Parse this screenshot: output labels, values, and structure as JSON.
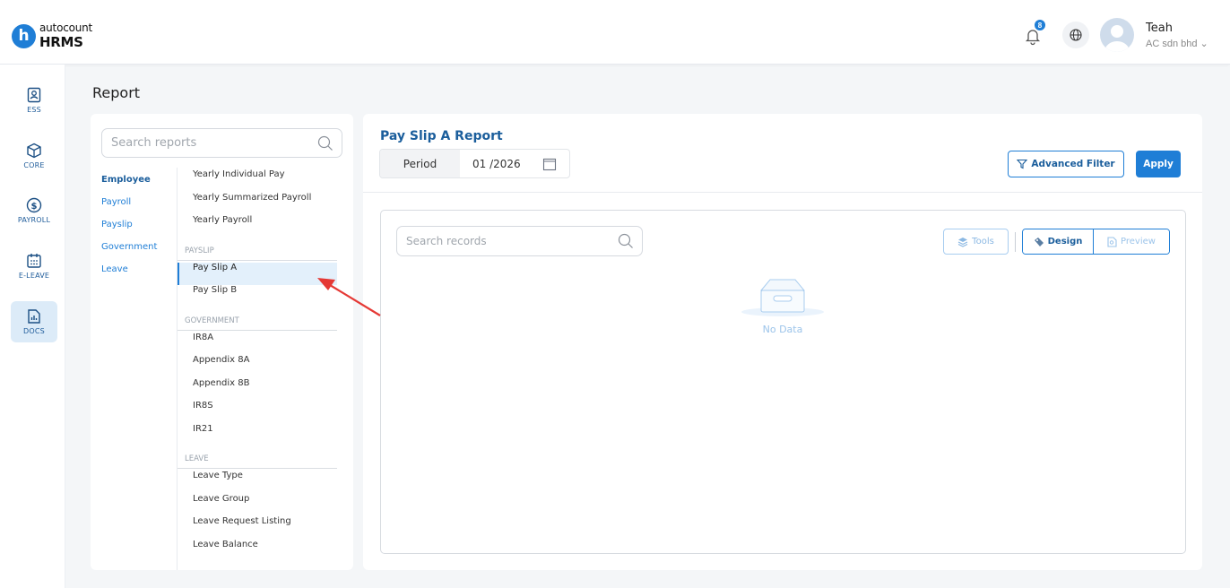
{
  "app": {
    "logo_small": "autocount",
    "logo_big": "HRMS"
  },
  "header": {
    "notification_count": "8",
    "user_name": "Teah",
    "company": "AC sdn bhd"
  },
  "rail": [
    {
      "label": "ESS",
      "icon": "ess-icon"
    },
    {
      "label": "CORE",
      "icon": "core-icon"
    },
    {
      "label": "PAYROLL",
      "icon": "payroll-icon"
    },
    {
      "label": "E-LEAVE",
      "icon": "calendar-icon"
    },
    {
      "label": "DOCS",
      "icon": "docs-icon",
      "active": true
    }
  ],
  "page": {
    "title": "Report"
  },
  "reports": {
    "search_placeholder": "Search reports",
    "categories": [
      "Employee",
      "Payroll",
      "Payslip",
      "Government",
      "Leave"
    ],
    "active_category": "Employee",
    "employee_items": [
      "Yearly Individual Pay",
      "Yearly Summarized Payroll",
      "Yearly Payroll"
    ],
    "payslip_header": "PAYSLIP",
    "payslip_items": [
      "Pay Slip A",
      "Pay Slip B"
    ],
    "active_item": "Pay Slip A",
    "government_header": "GOVERNMENT",
    "government_items": [
      "IR8A",
      "Appendix 8A",
      "Appendix 8B",
      "IR8S",
      "IR21"
    ],
    "leave_header": "LEAVE",
    "leave_items": [
      "Leave Type",
      "Leave Group",
      "Leave Request Listing",
      "Leave Balance"
    ]
  },
  "main": {
    "report_title": "Pay Slip A Report",
    "period_label": "Period",
    "period_value": "01 /2026",
    "advanced_filter_label": "Advanced Filter",
    "apply_label": "Apply",
    "records_search_placeholder": "Search records",
    "tools_label": "Tools",
    "design_label": "Design",
    "preview_label": "Preview",
    "empty_text": "No Data"
  },
  "colors": {
    "accent": "#1f7ed6",
    "title": "#1b5e9c",
    "annotation_arrow": "#e53935"
  }
}
